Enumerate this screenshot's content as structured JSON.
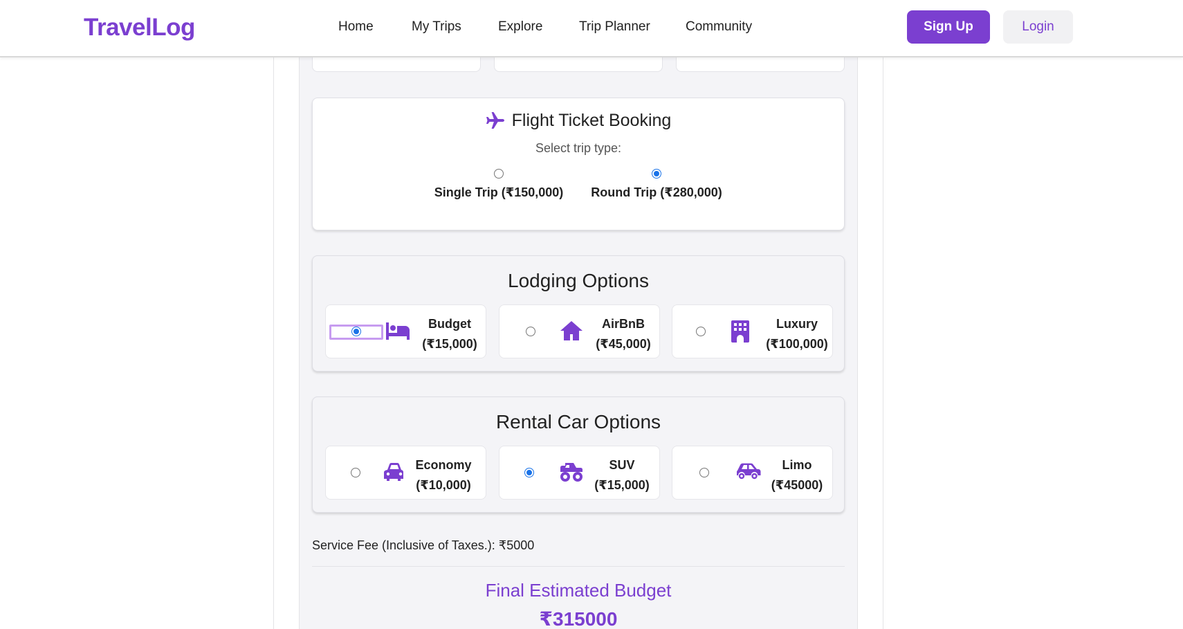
{
  "header": {
    "logo": "TravelLog",
    "nav": [
      "Home",
      "My Trips",
      "Explore",
      "Trip Planner",
      "Community"
    ],
    "signup_label": "Sign Up",
    "login_label": "Login"
  },
  "flight": {
    "title": "Flight Ticket Booking",
    "subtitle": "Select trip type:",
    "options": [
      {
        "label": "Single Trip (₹150,000)",
        "selected": false
      },
      {
        "label": "Round Trip (₹280,000)",
        "selected": true
      }
    ]
  },
  "lodging": {
    "title": "Lodging Options",
    "options": [
      {
        "name": "Budget",
        "price": "(₹15,000)",
        "icon": "bed-icon",
        "selected": true
      },
      {
        "name": "AirBnB",
        "price": "(₹45,000)",
        "icon": "house-icon",
        "selected": false
      },
      {
        "name": "Luxury",
        "price": "(₹100,000)",
        "icon": "hotel-building-icon",
        "selected": false
      }
    ]
  },
  "rental": {
    "title": "Rental Car Options",
    "options": [
      {
        "name": "Economy",
        "price": "(₹10,000)",
        "icon": "car-icon",
        "selected": false
      },
      {
        "name": "SUV",
        "price": "(₹15,000)",
        "icon": "monster-truck-icon",
        "selected": true
      },
      {
        "name": "Limo",
        "price": "(₹45000)",
        "icon": "car-side-icon",
        "selected": false
      }
    ]
  },
  "summary": {
    "service_fee": "Service Fee (Inclusive of Taxes.): ₹5000",
    "final_title": "Final Estimated Budget",
    "final_amount": "₹315000"
  },
  "colors": {
    "accent": "#7b3fd0",
    "radio_checked": "#1a73e8",
    "panel_bg": "#f4f4f7"
  }
}
